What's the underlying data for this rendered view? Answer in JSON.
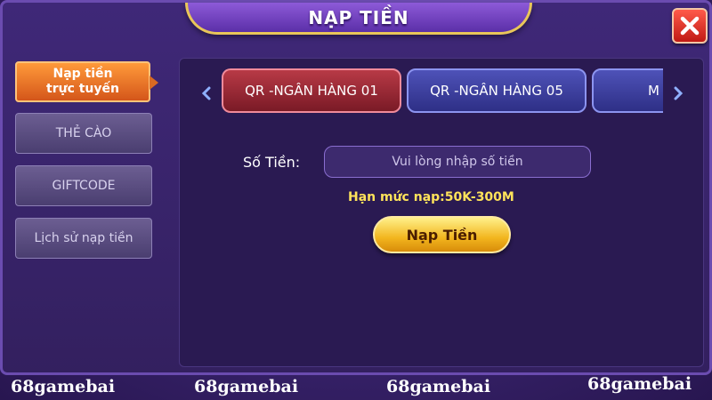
{
  "dialog": {
    "title": "NẠP TIỀN"
  },
  "sidebar": {
    "items": [
      {
        "label_line1": "Nạp tiền",
        "label_line2": "trực tuyến",
        "active": true
      },
      {
        "label": "THẺ CÀO",
        "active": false
      },
      {
        "label": "GIFTCODE",
        "active": false
      },
      {
        "label": "Lịch sử nạp tiền",
        "active": false
      }
    ]
  },
  "banks": {
    "tabs": [
      {
        "label": "QR -NGÂN HÀNG 01",
        "active": true
      },
      {
        "label": "QR -NGÂN HÀNG 05",
        "active": false
      },
      {
        "label": "M",
        "active": false
      }
    ]
  },
  "form": {
    "amount_label": "Số Tiền:",
    "amount_placeholder": "Vui lòng nhập số tiền",
    "limit_text": "Hạn mức nạp:50K-300M",
    "submit_label": "Nạp Tiền"
  },
  "watermark": {
    "texts": [
      "68gamebai",
      "68gamebai",
      "68gamebai",
      "68gamebai"
    ]
  },
  "icons": {
    "close": "close-icon",
    "left_arrow": "chevron-left-icon",
    "right_arrow": "chevron-right-icon"
  },
  "colors": {
    "accent_orange": "#d4561a",
    "gold": "#f2b51e",
    "active_bank": "#7a1a26",
    "inactive_bank": "#2e2f86",
    "limit_yellow": "#ffe35a"
  }
}
